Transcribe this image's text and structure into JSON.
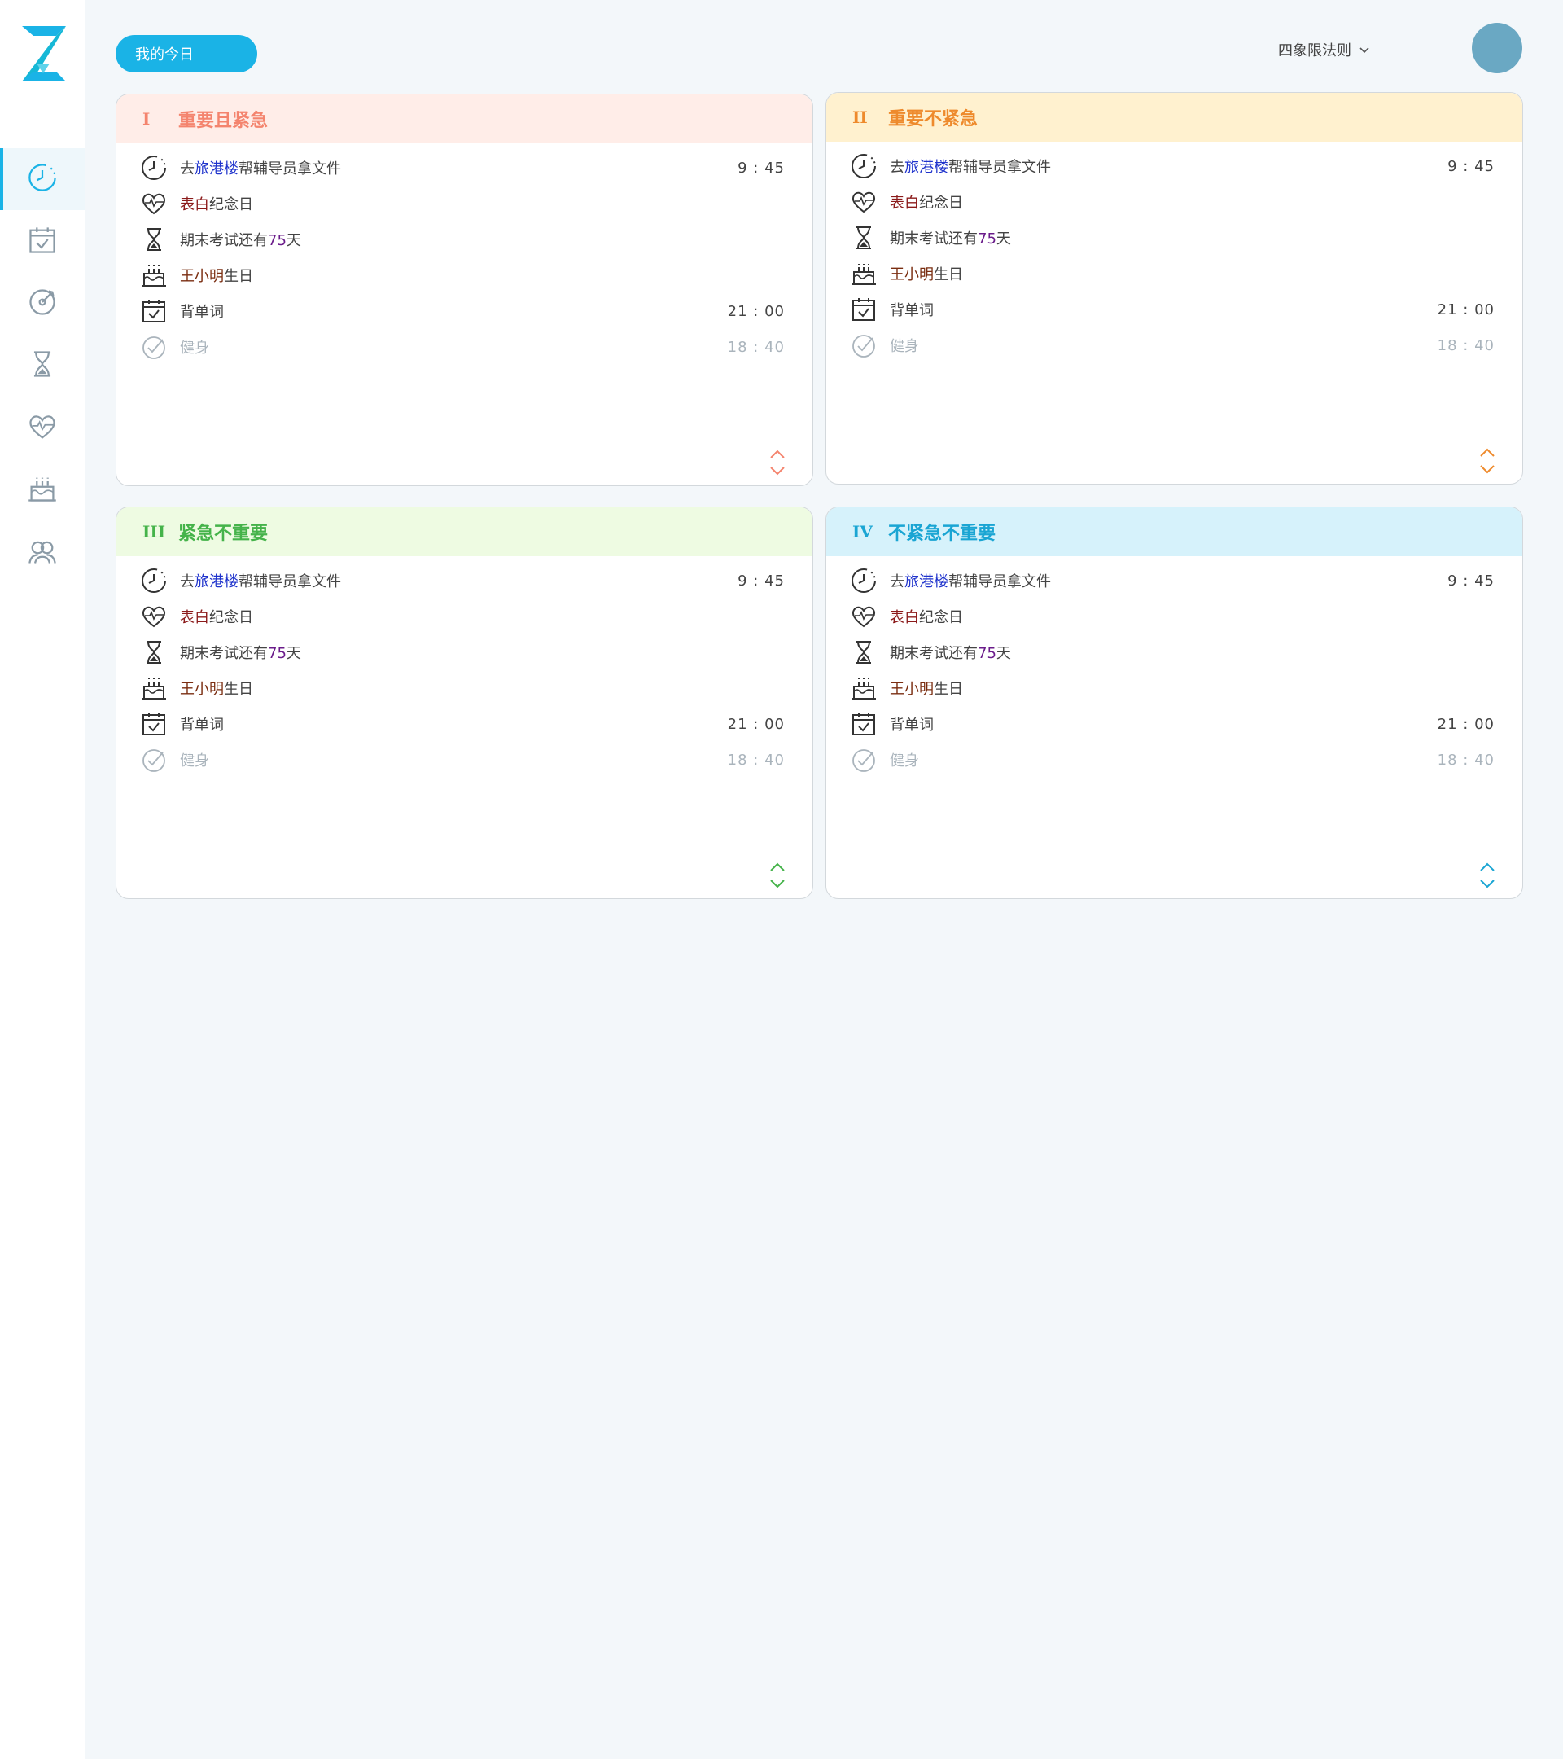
{
  "header": {
    "today_button": "我的今日",
    "rule_select": "四象限法则"
  },
  "colors": {
    "accent": "#1ab3e6",
    "q1_bg": "#ffede8",
    "q1_fg": "#f4846e",
    "q2_bg": "#fff1cf",
    "q2_fg": "#ee8a2c",
    "q3_bg": "#eefbe2",
    "q3_fg": "#45b34a",
    "q4_bg": "#d6f2fb",
    "q4_fg": "#1aa5d3"
  },
  "sidebar": {
    "items": [
      {
        "name": "clock-icon"
      },
      {
        "name": "calendar-check-icon"
      },
      {
        "name": "target-icon"
      },
      {
        "name": "hourglass-icon"
      },
      {
        "name": "heart-icon"
      },
      {
        "name": "cake-icon"
      },
      {
        "name": "friends-icon"
      }
    ]
  },
  "quadrants": [
    {
      "num": "I",
      "title": "重要且紧急",
      "rows": [
        {
          "icon": "clock-icon",
          "pre": "去",
          "hl": "旅港楼",
          "post": "帮辅导员拿文件",
          "time": "9 : 45"
        },
        {
          "icon": "heart-icon",
          "pre": "",
          "hl": "表白",
          "post": "纪念日",
          "time": ""
        },
        {
          "icon": "hourglass-icon",
          "pre": "期末考试还有",
          "hl": "75",
          "post": "天",
          "time": ""
        },
        {
          "icon": "cake-icon",
          "pre": "",
          "hl": "王小明",
          "post": "生日",
          "time": ""
        },
        {
          "icon": "calendar-check-icon",
          "pre": "背单词",
          "hl": "",
          "post": "",
          "time": "21 : 00"
        },
        {
          "icon": "check-circle-icon",
          "pre": "健身",
          "hl": "",
          "post": "",
          "time": "18 : 40"
        }
      ]
    },
    {
      "num": "II",
      "title": "重要不紧急",
      "rows": [
        {
          "icon": "clock-icon",
          "pre": "去",
          "hl": "旅港楼",
          "post": "帮辅导员拿文件",
          "time": "9 : 45"
        },
        {
          "icon": "heart-icon",
          "pre": "",
          "hl": "表白",
          "post": "纪念日",
          "time": ""
        },
        {
          "icon": "hourglass-icon",
          "pre": "期末考试还有",
          "hl": "75",
          "post": "天",
          "time": ""
        },
        {
          "icon": "cake-icon",
          "pre": "",
          "hl": "王小明",
          "post": "生日",
          "time": ""
        },
        {
          "icon": "calendar-check-icon",
          "pre": "背单词",
          "hl": "",
          "post": "",
          "time": "21 : 00"
        },
        {
          "icon": "check-circle-icon",
          "pre": "健身",
          "hl": "",
          "post": "",
          "time": "18 : 40"
        }
      ]
    },
    {
      "num": "III",
      "title": "紧急不重要",
      "rows": [
        {
          "icon": "clock-icon",
          "pre": "去",
          "hl": "旅港楼",
          "post": "帮辅导员拿文件",
          "time": "9 : 45"
        },
        {
          "icon": "heart-icon",
          "pre": "",
          "hl": "表白",
          "post": "纪念日",
          "time": ""
        },
        {
          "icon": "hourglass-icon",
          "pre": "期末考试还有",
          "hl": "75",
          "post": "天",
          "time": ""
        },
        {
          "icon": "cake-icon",
          "pre": "",
          "hl": "王小明",
          "post": "生日",
          "time": ""
        },
        {
          "icon": "calendar-check-icon",
          "pre": "背单词",
          "hl": "",
          "post": "",
          "time": "21 : 00"
        },
        {
          "icon": "check-circle-icon",
          "pre": "健身",
          "hl": "",
          "post": "",
          "time": "18 : 40"
        }
      ]
    },
    {
      "num": "IV",
      "title": "不紧急不重要",
      "rows": [
        {
          "icon": "clock-icon",
          "pre": "去",
          "hl": "旅港楼",
          "post": "帮辅导员拿文件",
          "time": "9 : 45"
        },
        {
          "icon": "heart-icon",
          "pre": "",
          "hl": "表白",
          "post": "纪念日",
          "time": ""
        },
        {
          "icon": "hourglass-icon",
          "pre": "期末考试还有",
          "hl": "75",
          "post": "天",
          "time": ""
        },
        {
          "icon": "cake-icon",
          "pre": "",
          "hl": "王小明",
          "post": "生日",
          "time": ""
        },
        {
          "icon": "calendar-check-icon",
          "pre": "背单词",
          "hl": "",
          "post": "",
          "time": "21 : 00"
        },
        {
          "icon": "check-circle-icon",
          "pre": "健身",
          "hl": "",
          "post": "",
          "time": "18 : 40"
        }
      ]
    }
  ]
}
